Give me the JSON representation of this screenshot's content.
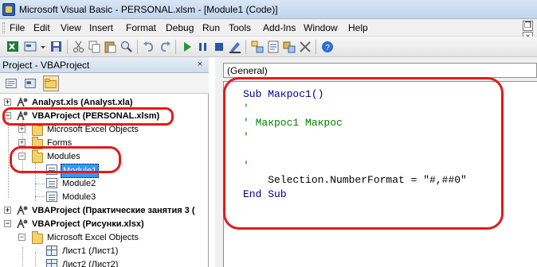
{
  "window": {
    "title": "Microsoft Visual Basic - PERSONAL.xlsm - [Module1 (Code)]"
  },
  "menu": [
    "File",
    "Edit",
    "View",
    "Insert",
    "Format",
    "Debug",
    "Run",
    "Tools",
    "Add-Ins",
    "Window",
    "Help"
  ],
  "toolbar": {
    "icons": [
      "excel-view-icon",
      "insert-userform-icon",
      "save-icon",
      "cut-icon",
      "copy-icon",
      "paste-icon",
      "find-icon",
      "undo-icon",
      "redo-icon",
      "run-icon",
      "break-icon",
      "reset-icon",
      "design-mode-icon",
      "project-explorer-icon",
      "properties-icon",
      "object-browser-icon",
      "toolbox-icon",
      "help-icon"
    ]
  },
  "project_panel": {
    "title": "Project - VBAProject",
    "close": "×"
  },
  "tree": [
    {
      "label": "Analyst.xls (Analyst.xla)",
      "bold": true
    },
    {
      "label": "VBAProject (PERSONAL.xlsm)",
      "bold": true
    },
    {
      "label": "Microsoft Excel Objects",
      "bold": false
    },
    {
      "label": "Forms",
      "bold": false
    },
    {
      "label": "Modules",
      "bold": false
    },
    {
      "label": "Module1",
      "bold": false,
      "selected": true
    },
    {
      "label": "Module2",
      "bold": false
    },
    {
      "label": "Module3",
      "bold": false
    },
    {
      "label": "VBAProject (Практические занятия 3 (",
      "bold": true
    },
    {
      "label": "VBAProject (Рисунки.xlsx)",
      "bold": true
    },
    {
      "label": "Microsoft Excel Objects",
      "bold": false
    },
    {
      "label": "Лист1 (Лист1)",
      "bold": false
    },
    {
      "label": "Лист2 (Лист2)",
      "bold": false
    }
  ],
  "code": {
    "object_dropdown": "(General)",
    "lines": [
      "Sub Макрос1()",
      "'",
      "' Макрос1 Макрос",
      "'",
      "",
      "'",
      "    Selection.NumberFormat = \"#,##0\"",
      "End Sub"
    ]
  },
  "colors": {
    "annotation": "#e21b1b",
    "keyword": "#00008b",
    "comment": "#008000",
    "selection": "#3399ff"
  }
}
